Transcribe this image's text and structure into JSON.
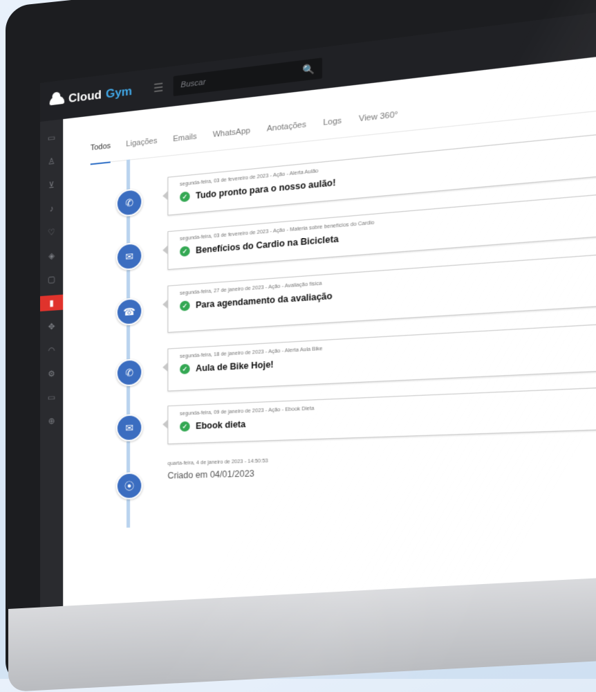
{
  "app": {
    "logo_primary": "Cloud",
    "logo_accent": "Gym",
    "accent_color": "#41a7e6"
  },
  "search": {
    "placeholder": "Buscar"
  },
  "tabs": [
    "Todos",
    "Ligações",
    "Emails",
    "WhatsApp",
    "Anotações",
    "Logs",
    "View 360°"
  ],
  "active_tab": "Todos",
  "sidebar_icons": [
    "monitor-icon",
    "user-icon",
    "cart-icon",
    "music-icon",
    "heart-icon",
    "diamond-icon",
    "folder-icon",
    "chart-icon",
    "move-icon",
    "headset-icon",
    "settings-icon",
    "card-icon",
    "puzzle-icon"
  ],
  "timeline": [
    {
      "meta": "segunda-feira, 03 de fevereiro de 2023 - Ação - Alerta Aulão",
      "title": "Tudo pronto para o nosso aulão!",
      "channel": "whatsapp-icon"
    },
    {
      "meta": "segunda-feira, 03 de fevereiro de 2023 - Ação - Materia sobre benefícios do Cardio",
      "title": "Benefícios do Cardio na Bicicleta",
      "channel": "email-icon"
    },
    {
      "meta": "segunda-feira, 27 de janeiro de 2023 - Ação - Avaliação física",
      "title": "Para agendamento da avaliação",
      "channel": "phone-icon"
    },
    {
      "meta": "segunda-feira, 18 de janeiro de 2023 - Ação - Alerta Aula Bike",
      "title": "Aula de Bike Hoje!",
      "channel": "whatsapp-icon"
    },
    {
      "meta": "segunda-feira, 09 de janeiro de 2023 - Ação - Ebook Dieta",
      "title": "Ebook dieta",
      "channel": "email-icon"
    }
  ],
  "created": {
    "meta": "quarta-feira, 4 de janeiro de 2023 - 14:50:53",
    "title": "Criado em 04/01/2023"
  }
}
